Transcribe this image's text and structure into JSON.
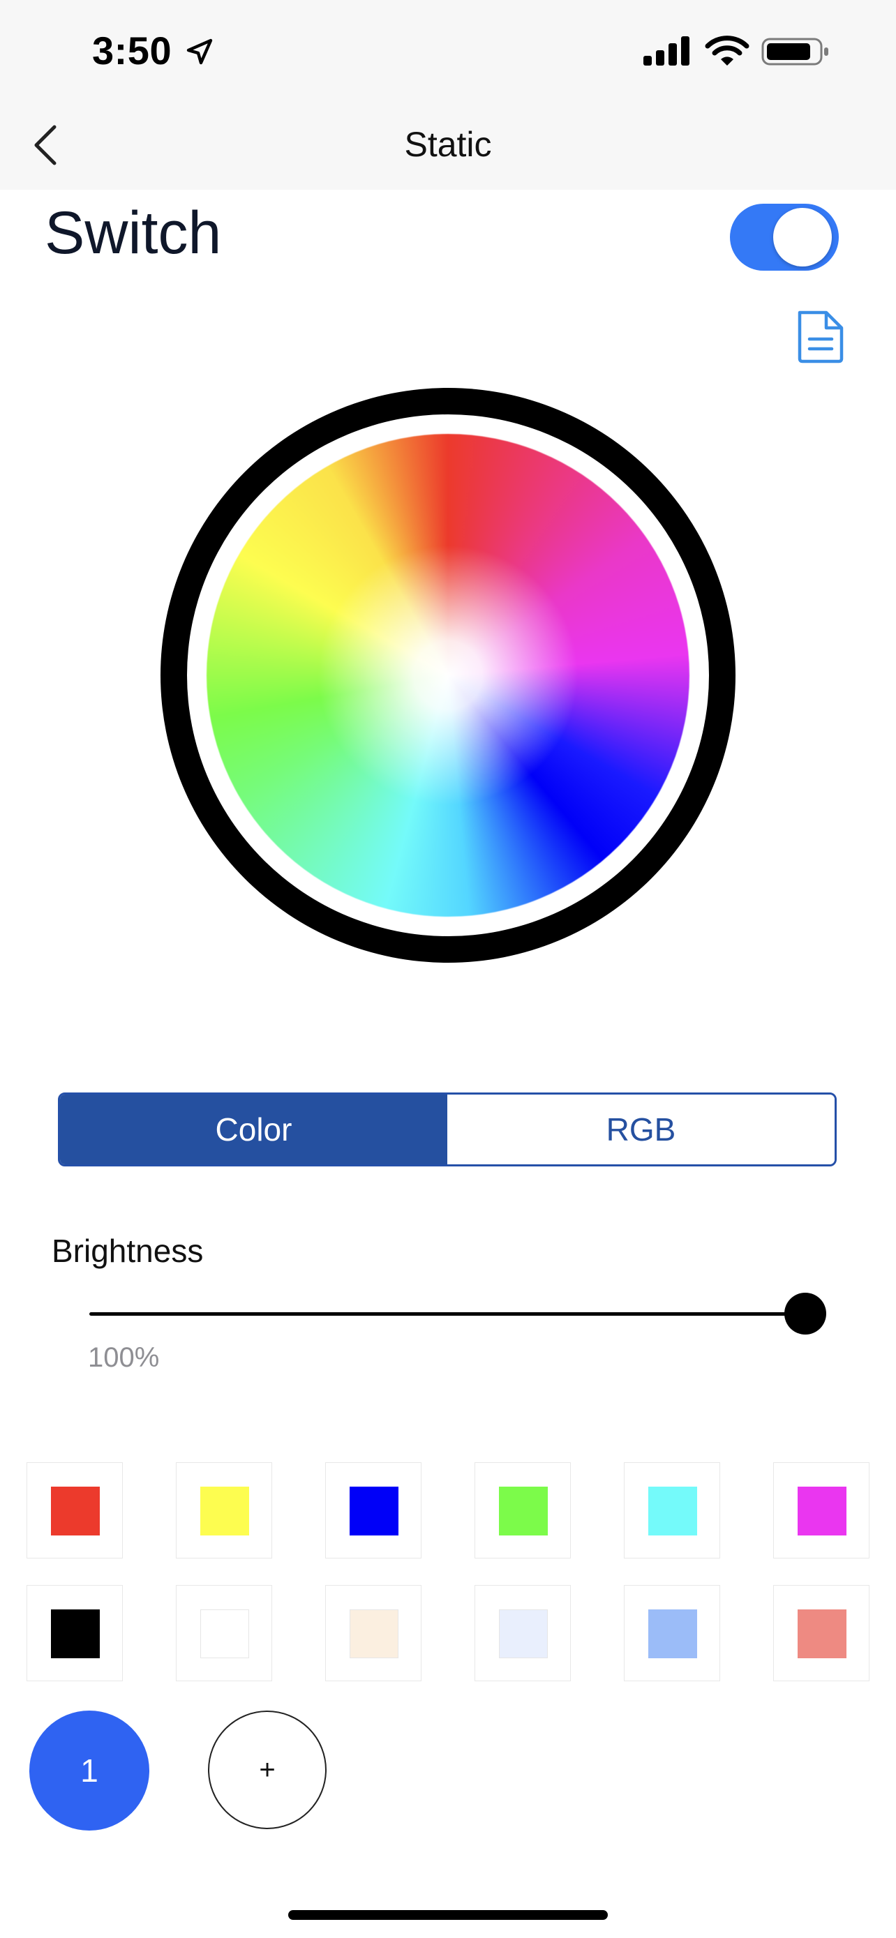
{
  "status_bar": {
    "time": "3:50"
  },
  "nav": {
    "title": "Static"
  },
  "switch": {
    "label": "Switch",
    "on": true
  },
  "mode_tabs": {
    "color_label": "Color",
    "rgb_label": "RGB",
    "selected": "Color"
  },
  "brightness": {
    "label": "Brightness",
    "value_text": "100%",
    "value": 1.0
  },
  "swatches": {
    "row1": [
      "#ec3a2c",
      "#fdfd50",
      "#0000f8",
      "#7cfb4a",
      "#74fafa",
      "#ea36f0"
    ],
    "row2": [
      "#000000",
      "#ffffff",
      "#fbefe0",
      "#e9effd",
      "#9bbcf8",
      "#ee8a82"
    ]
  },
  "presets": {
    "first_label": "1",
    "add_label": "+"
  },
  "colors": {
    "accent": "#3479f6",
    "tab_active": "#2550a0",
    "preset_active": "#2f63f2"
  },
  "icons": [
    "location-arrow-icon",
    "signal-icon",
    "wifi-icon",
    "battery-icon",
    "chevron-left-icon",
    "document-icon"
  ]
}
